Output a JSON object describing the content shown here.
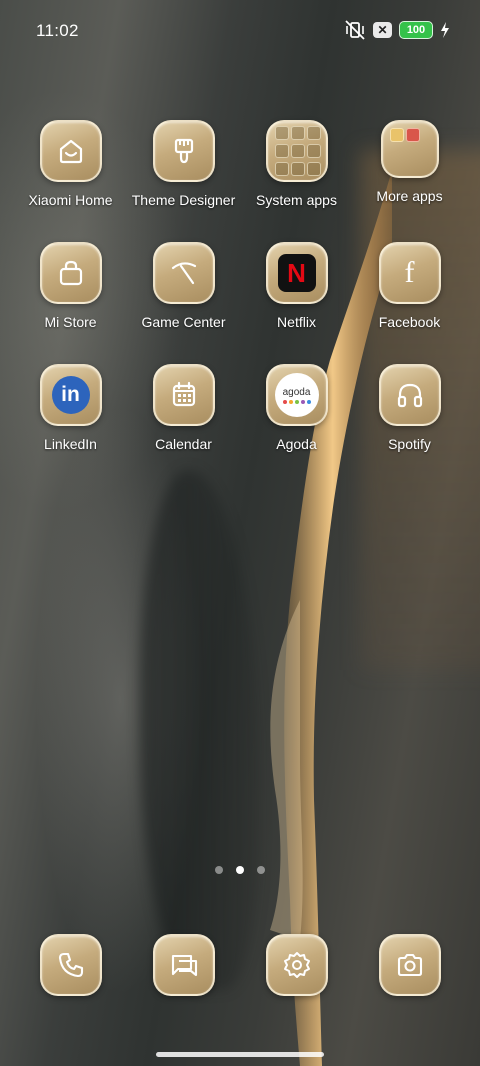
{
  "status_bar": {
    "time": "11:02",
    "icons": [
      "vibrate-off-icon",
      "notification-x-icon",
      "battery-icon",
      "charging-bolt-icon"
    ],
    "notification_badge": "✕",
    "battery_level": "100",
    "battery_color": "#35c24a"
  },
  "apps": {
    "row1": [
      {
        "label": "Xiaomi Home",
        "icon": "xiaomi-home-icon"
      },
      {
        "label": "Theme Designer",
        "icon": "paintbrush-icon"
      },
      {
        "label": "System apps",
        "icon": "folder-icon"
      },
      {
        "label": "More apps",
        "icon": "folder-icon"
      }
    ],
    "row2": [
      {
        "label": "Mi Store",
        "icon": "shopping-bag-icon"
      },
      {
        "label": "Game Center",
        "icon": "pickaxe-icon"
      },
      {
        "label": "Netflix",
        "icon": "netflix-icon",
        "glyph": "N"
      },
      {
        "label": "Facebook",
        "icon": "facebook-icon",
        "glyph": "f"
      }
    ],
    "row3": [
      {
        "label": "LinkedIn",
        "icon": "linkedin-icon",
        "glyph": "in"
      },
      {
        "label": "Calendar",
        "icon": "calendar-icon"
      },
      {
        "label": "Agoda",
        "icon": "agoda-icon",
        "glyph": "agoda"
      },
      {
        "label": "Spotify",
        "icon": "headphones-icon"
      }
    ]
  },
  "pager": {
    "pages": 3,
    "active_page": 2
  },
  "dock": [
    {
      "name": "Phone",
      "icon": "phone-icon"
    },
    {
      "name": "Messages",
      "icon": "message-icon"
    },
    {
      "name": "Settings",
      "icon": "gear-icon"
    },
    {
      "name": "Camera",
      "icon": "camera-icon"
    }
  ],
  "colors": {
    "tile_gold": "#c5ab7d",
    "netflix_red": "#e50914",
    "linkedin_blue": "#2d64bc"
  }
}
